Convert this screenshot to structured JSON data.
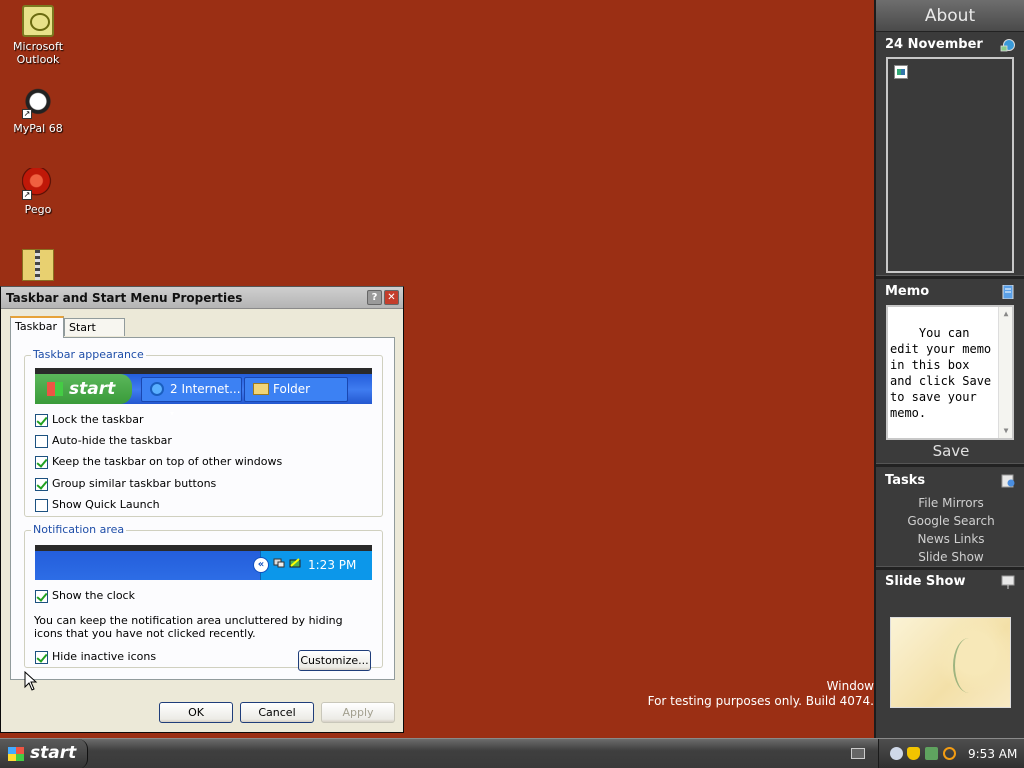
{
  "desktop": {
    "icons": [
      {
        "label": "Microsoft Outlook",
        "icon": "outlook-icon"
      },
      {
        "label": "MyPal 68",
        "icon": "mypal-icon"
      },
      {
        "label": "Pego",
        "icon": "pego-icon"
      },
      {
        "label": "",
        "icon": "zip-folder-icon"
      }
    ],
    "watermark": {
      "line1": "Window",
      "line2": "For testing purposes only. Build 4074."
    }
  },
  "sidebar": {
    "about": "About",
    "date": "24 November",
    "memo": {
      "title": "Memo",
      "text": "You can edit your memo in this box and click Save to save your memo.",
      "save_label": "Save"
    },
    "tasks": {
      "title": "Tasks",
      "items": [
        "File Mirrors",
        "Google Search",
        "News Links",
        "Slide Show"
      ]
    },
    "slideshow": {
      "title": "Slide Show"
    }
  },
  "dialog": {
    "title": "Taskbar and Start Menu Properties",
    "help_label": "?",
    "close_label": "✕",
    "tabs": [
      {
        "label": "Taskbar",
        "active": true
      },
      {
        "label": "Start Menu",
        "active": false
      }
    ],
    "taskbar_appearance": {
      "label": "Taskbar appearance",
      "preview": {
        "start_label": "start",
        "button1": "2 Internet...",
        "button2": "Folder"
      },
      "options": [
        {
          "label": "Lock the taskbar",
          "checked": true
        },
        {
          "label": "Auto-hide the taskbar",
          "checked": false
        },
        {
          "label": "Keep the taskbar on top of other windows",
          "checked": true
        },
        {
          "label": "Group similar taskbar buttons",
          "checked": true
        },
        {
          "label": "Show Quick Launch",
          "checked": false
        }
      ]
    },
    "notification_area": {
      "label": "Notification area",
      "preview_clock": "1:23 PM",
      "show_clock": {
        "label": "Show the clock",
        "checked": true
      },
      "explanation": "You can keep the notification area uncluttered by hiding icons that you have not clicked recently.",
      "hide_inactive": {
        "label": "Hide inactive icons",
        "checked": true
      },
      "customize_label": "Customize..."
    },
    "buttons": {
      "ok": "OK",
      "cancel": "Cancel",
      "apply": "Apply"
    }
  },
  "taskbar": {
    "start_label": "start",
    "clock": "9:53 AM"
  }
}
